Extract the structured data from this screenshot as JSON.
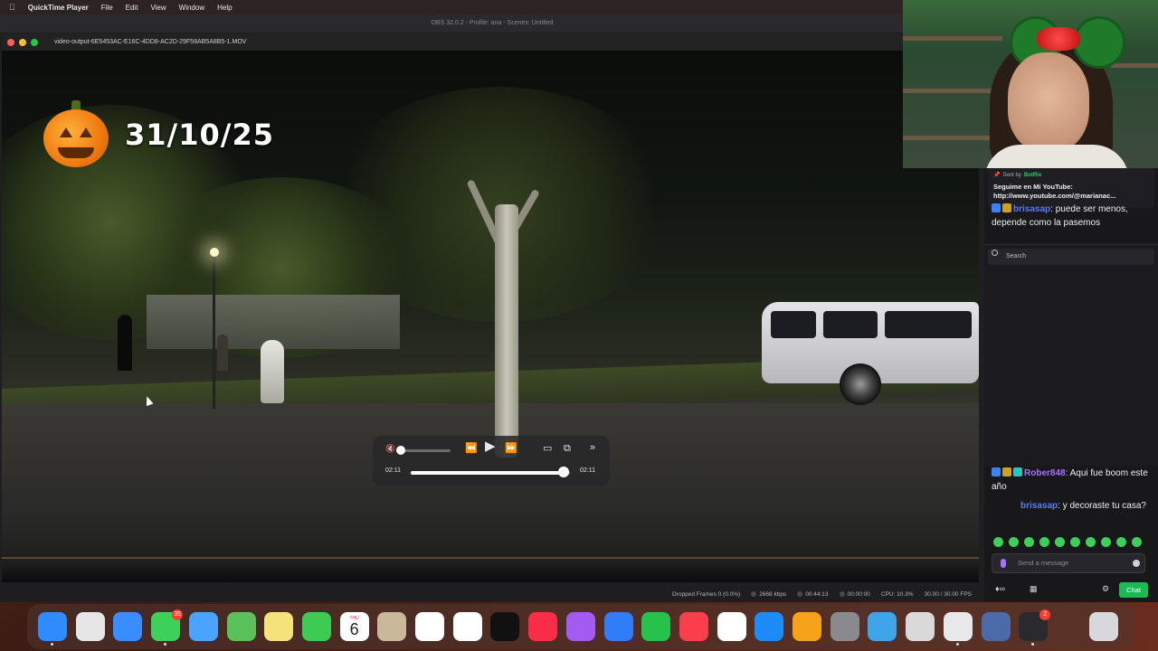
{
  "menubar": {
    "app": "QuickTime Player",
    "items": [
      "File",
      "Edit",
      "View",
      "Window",
      "Help"
    ]
  },
  "obs": {
    "title": "OBS 32.0.2 - Profile: ana - Scenes: Untitled",
    "status": {
      "dropped_frames": "Dropped Frames 0 (0.0%)",
      "bitrate": "2668 kbps",
      "stream_time": "00:44:13",
      "record_time": "00:00:00",
      "cpu": "CPU: 10.3%",
      "fps": "30.00 / 30.00 FPS"
    }
  },
  "quicktime": {
    "title": "video-output-6E5453AC-E16C-4DD8-AC2D-29F58AB5A8B5-1.MOV",
    "overlay_date": "31/10/25",
    "controls": {
      "current_time": "02:11",
      "remaining_time": "02:11",
      "progress": 0.96,
      "volume": 0.0
    }
  },
  "chat": {
    "pinned": {
      "sent_by_label": "Sent by",
      "bot_name": "BotRix",
      "message": "Seguime en Mi YouTube: http://www.youtube.com/@marianac..."
    },
    "messages_top": [
      {
        "user": "brisasap",
        "text": ": puede ser menos, depende como la pasemos"
      }
    ],
    "search_placeholder": "Search",
    "messages": [
      {
        "user": "Rober848",
        "text": ": Aqui fue boom este año"
      },
      {
        "user": "brisasap",
        "text": ": y decoraste tu casa?"
      }
    ],
    "input_placeholder": "Send a message",
    "chat_button": "Chat",
    "user_colors": {
      "brisasap": "#5c7cfa",
      "Rober848": "#a970ff"
    }
  },
  "dock": {
    "messages_badge": "35",
    "calendar_day": "THU",
    "calendar_date": "6",
    "record_badge": "2",
    "icons": [
      "finder-icon",
      "launchpad-icon",
      "safari-icon",
      "messages-icon",
      "mail-icon",
      "maps-icon",
      "notes-icon",
      "facetime-icon",
      "calendar-icon",
      "contacts-icon",
      "reminders-icon",
      "freeform-icon",
      "appletv-icon",
      "music-icon",
      "podcasts-icon",
      "keynote-icon",
      "numbers-icon",
      "news-icon",
      "photos-icon",
      "appstore-icon",
      "pages-icon",
      "settings-icon",
      "folder-icon",
      "preview-icon",
      "quicktime-icon",
      "disk-icon",
      "obs-icon",
      "trash-icon"
    ]
  }
}
